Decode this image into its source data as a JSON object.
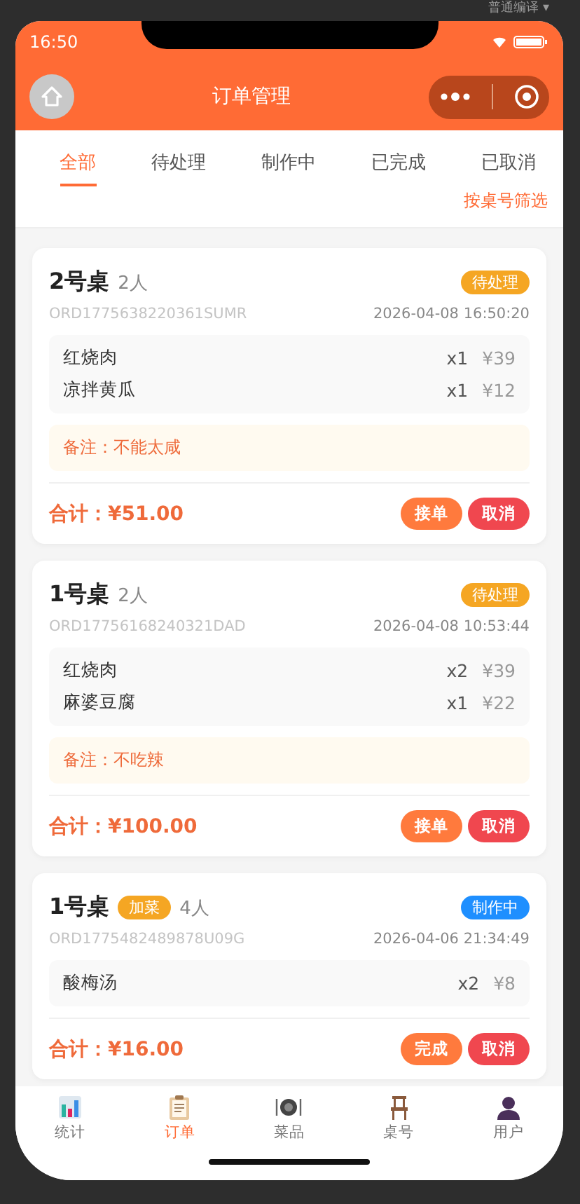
{
  "devtools": {
    "compile_mode": "普通编译 ▾"
  },
  "status_bar": {
    "time": "16:50"
  },
  "nav": {
    "title": "订单管理"
  },
  "tabs": [
    {
      "label": "全部",
      "selected": true
    },
    {
      "label": "待处理",
      "selected": false
    },
    {
      "label": "制作中",
      "selected": false
    },
    {
      "label": "已完成",
      "selected": false
    },
    {
      "label": "已取消",
      "selected": false
    }
  ],
  "filter_link": "按桌号筛选",
  "orders": [
    {
      "table": "2号桌",
      "people": "2人",
      "status": {
        "label": "待处理",
        "kind": "pending"
      },
      "order_no": "ORD1775638220361SUMR",
      "time": "2026-04-08 16:50:20",
      "items": [
        {
          "name": "红烧肉",
          "qty": "x1",
          "price": "¥39"
        },
        {
          "name": "凉拌黄瓜",
          "qty": "x1",
          "price": "¥12"
        }
      ],
      "remark": "备注：不能太咸",
      "total": "合计：¥51.00",
      "actions": [
        {
          "label": "接单",
          "kind": "primary"
        },
        {
          "label": "取消",
          "kind": "danger"
        }
      ]
    },
    {
      "table": "1号桌",
      "people": "2人",
      "status": {
        "label": "待处理",
        "kind": "pending"
      },
      "order_no": "ORD17756168240321DAD",
      "time": "2026-04-08 10:53:44",
      "items": [
        {
          "name": "红烧肉",
          "qty": "x2",
          "price": "¥39"
        },
        {
          "name": "麻婆豆腐",
          "qty": "x1",
          "price": "¥22"
        }
      ],
      "remark": "备注：不吃辣",
      "total": "合计：¥100.00",
      "actions": [
        {
          "label": "接单",
          "kind": "primary"
        },
        {
          "label": "取消",
          "kind": "danger"
        }
      ]
    },
    {
      "table": "1号桌",
      "tag": "加菜",
      "people": "4人",
      "status": {
        "label": "制作中",
        "kind": "cooking"
      },
      "order_no": "ORD1775482489878U09G",
      "time": "2026-04-06 21:34:49",
      "items": [
        {
          "name": "酸梅汤",
          "qty": "x2",
          "price": "¥8"
        }
      ],
      "total": "合计：¥16.00",
      "actions": [
        {
          "label": "完成",
          "kind": "primary"
        },
        {
          "label": "取消",
          "kind": "danger"
        }
      ]
    }
  ],
  "bottom_tabs": [
    {
      "label": "统计",
      "kind": "chart",
      "selected": false
    },
    {
      "label": "订单",
      "kind": "clipboard",
      "selected": true
    },
    {
      "label": "菜品",
      "kind": "dish",
      "selected": false
    },
    {
      "label": "桌号",
      "kind": "chair",
      "selected": false
    },
    {
      "label": "用户",
      "kind": "user",
      "selected": false
    }
  ]
}
